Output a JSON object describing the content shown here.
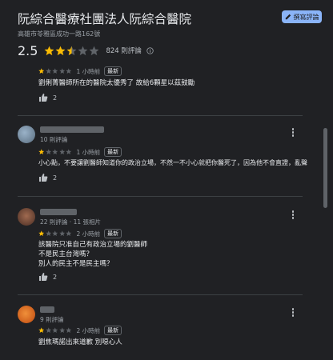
{
  "place": {
    "title": "阮綜合醫療社團法人阮綜合醫院",
    "address": "高雄市苓雅區成功一路162號",
    "write_review": "撰寫評論",
    "rating": "2.5",
    "rating_value": 2.5,
    "review_count": "824 則評論"
  },
  "labels": {
    "newest": "最新"
  },
  "colors": {
    "star": "#fbbc04",
    "star_empty": "#5f6368",
    "accent": "#8ab4f8"
  },
  "reviews": [
    {
      "stars": 1,
      "time": "1 小時前",
      "text": [
        "劉俐菁醫師所在的醫院太優秀了 故給6顆星以茲鼓勵"
      ],
      "likes": "2"
    },
    {
      "meta": "10 則評論",
      "stars": 1,
      "time": "1 小時前",
      "text": [
        "小心點，不要讓劉醫師知道你的政治立場，不然一不小心就把你醫死了，因為他不會直證，亂聲"
      ],
      "likes": "2"
    },
    {
      "meta": "22 則評論 · 11 張相片",
      "stars": 1,
      "time": "2 小時前",
      "text": [
        "該醫院只准自己有政治立場的劉醫師",
        "不是民主台灣嗎？",
        "別人的民主不是民主嗎？"
      ],
      "likes": "2"
    },
    {
      "meta": "9 則評論",
      "stars": 1,
      "time": "2 小時前",
      "text": [
        "劉焦瑪諾出來道歉 別噁心人"
      ]
    }
  ]
}
